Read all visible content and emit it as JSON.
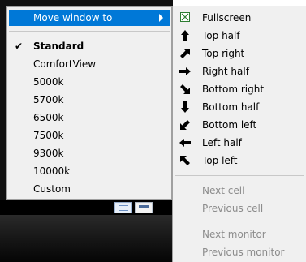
{
  "main_menu": {
    "move_window": "Move window to",
    "items": [
      {
        "label": "Standard",
        "checked": true
      },
      {
        "label": "ComfortView",
        "checked": false
      },
      {
        "label": "5000k",
        "checked": false
      },
      {
        "label": "5700k",
        "checked": false
      },
      {
        "label": "6500k",
        "checked": false
      },
      {
        "label": "7500k",
        "checked": false
      },
      {
        "label": "9300k",
        "checked": false
      },
      {
        "label": "10000k",
        "checked": false
      },
      {
        "label": "Custom",
        "checked": false
      }
    ],
    "check_glyph": "✔"
  },
  "submenu": {
    "positions": [
      {
        "label": "Fullscreen",
        "icon": "fullscreen-icon"
      },
      {
        "label": "Top half",
        "icon": "arrow-up-icon"
      },
      {
        "label": "Top right",
        "icon": "arrow-up-right-icon"
      },
      {
        "label": "Right half",
        "icon": "arrow-right-icon"
      },
      {
        "label": "Bottom right",
        "icon": "arrow-down-right-icon"
      },
      {
        "label": "Bottom half",
        "icon": "arrow-down-icon"
      },
      {
        "label": "Bottom left",
        "icon": "arrow-down-left-icon"
      },
      {
        "label": "Left half",
        "icon": "arrow-left-icon"
      },
      {
        "label": "Top left",
        "icon": "arrow-up-left-icon"
      }
    ],
    "cells": [
      {
        "label": "Next cell"
      },
      {
        "label": "Previous cell"
      }
    ],
    "monitors": [
      {
        "label": "Next monitor"
      },
      {
        "label": "Previous monitor"
      }
    ]
  },
  "colors": {
    "highlight": "#0078d7",
    "menu_bg": "#f0f0f0",
    "disabled_text": "#8c8c8c",
    "fullscreen_icon": "#2e7d32"
  }
}
